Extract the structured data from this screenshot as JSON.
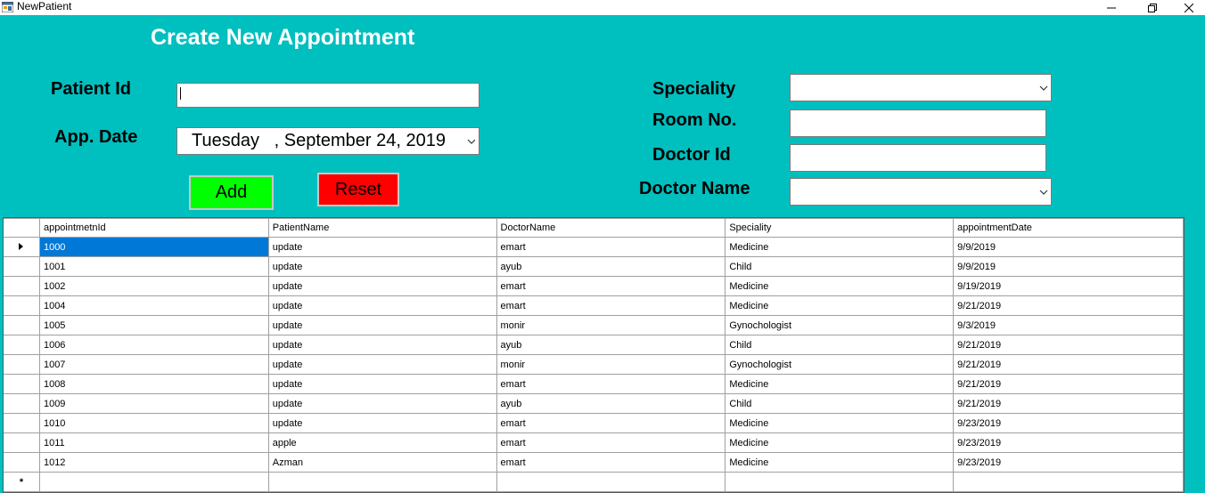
{
  "window": {
    "title": "NewPatient"
  },
  "form": {
    "heading": "Create New Appointment",
    "patient_id_label": "Patient Id",
    "patient_id_value": "",
    "app_date_label": "App. Date",
    "app_date_value": "Tuesday   , September 24, 2019",
    "speciality_label": "Speciality",
    "speciality_value": "",
    "room_label": "Room No.",
    "room_value": "",
    "doctor_id_label": "Doctor Id",
    "doctor_id_value": "",
    "doctor_name_label": "Doctor Name",
    "doctor_name_value": "",
    "add_label": "Add",
    "reset_label": "Reset"
  },
  "colors": {
    "background": "#00BFBF",
    "add": "#00FF00",
    "reset": "#FF0000",
    "selection": "#0078D7"
  },
  "grid": {
    "columns": [
      "appointmetnId",
      "PatientName",
      "DoctorName",
      "Speciality",
      "appointmentDate"
    ],
    "rows": [
      [
        "1000",
        "update",
        "emart",
        "Medicine",
        "9/9/2019"
      ],
      [
        "1001",
        "update",
        "ayub",
        "Child",
        "9/9/2019"
      ],
      [
        "1002",
        "update",
        "emart",
        "Medicine",
        "9/19/2019"
      ],
      [
        "1004",
        "update",
        "emart",
        "Medicine",
        "9/21/2019"
      ],
      [
        "1005",
        "update",
        "monir",
        "Gynochologist",
        "9/3/2019"
      ],
      [
        "1006",
        "update",
        "ayub",
        "Child",
        "9/21/2019"
      ],
      [
        "1007",
        "update",
        "monir",
        "Gynochologist",
        "9/21/2019"
      ],
      [
        "1008",
        "update",
        "emart",
        "Medicine",
        "9/21/2019"
      ],
      [
        "1009",
        "update",
        "ayub",
        "Child",
        "9/21/2019"
      ],
      [
        "1010",
        "update",
        "emart",
        "Medicine",
        "9/23/2019"
      ],
      [
        "1011",
        "apple",
        "emart",
        "Medicine",
        "9/23/2019"
      ],
      [
        "1012",
        "Azman",
        "emart",
        "Medicine",
        "9/23/2019"
      ]
    ],
    "new_row_marker": "*"
  }
}
